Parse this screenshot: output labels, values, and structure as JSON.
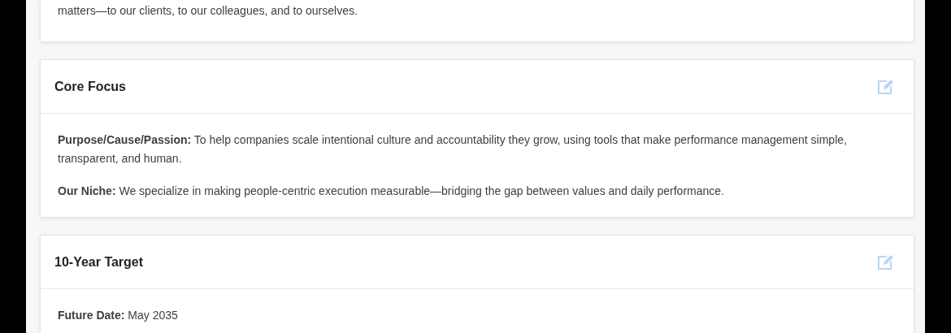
{
  "sections": [
    {
      "paragraphs": [
        "matters—to our clients, to our colleagues, and to ourselves."
      ]
    },
    {
      "title": "Core Focus",
      "paragraphs": [
        "**Purpose/Cause/Passion:** To help companies scale intentional culture and accountability they grow, using tools that make performance management simple, transparent, and human.",
        "**Our Niche:** We specialize in making people-centric execution measurable—bridging the gap between values and daily performance."
      ]
    },
    {
      "title": "10-Year Target",
      "paragraphs": [
        "**Future Date:** May 2035"
      ]
    }
  ]
}
